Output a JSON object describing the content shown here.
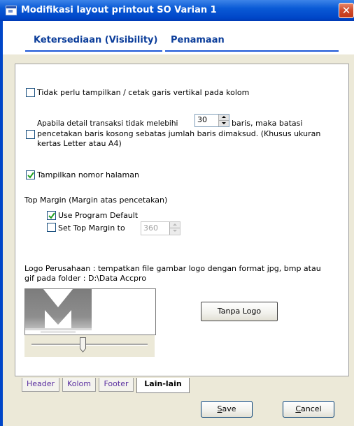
{
  "window": {
    "title": "Modifikasi layout printout SO Varian 1",
    "close_symbol": "✕"
  },
  "top_tabs": [
    {
      "label": "Ketersediaan (Visibility)"
    },
    {
      "label": "Penamaan"
    }
  ],
  "options": {
    "no_vertical_lines": {
      "label": "Tidak perlu tampilkan / cetak garis vertikal pada kolom",
      "checked": false
    },
    "limit_blank_rows": {
      "line1_prefix": "Apabila detail transaksi tidak melebihi",
      "value": "30",
      "line1_suffix": "baris, maka batasi",
      "line2": "pencetakan baris kosong sebatas jumlah baris dimaksud. (Khusus ukuran",
      "line3": "kertas Letter atau A4)",
      "checked": false
    },
    "show_page_number": {
      "label": "Tampilkan nomor halaman",
      "checked": true
    }
  },
  "top_margin": {
    "heading": "Top Margin (Margin atas pencetakan)",
    "use_default": {
      "label": "Use Program Default",
      "checked": true
    },
    "set_margin": {
      "label": "Set Top Margin to",
      "checked": false,
      "value": "360"
    }
  },
  "logo": {
    "line1": "Logo Perusahaan : tempatkan file gambar logo dengan format jpg, bmp atau",
    "line2": "gif pada folder : D:\\Data Accpro",
    "no_logo_button": "Tanpa Logo",
    "slider_value_percent": 44
  },
  "bottom_tabs": [
    {
      "label": "Header",
      "active": false
    },
    {
      "label": "Kolom",
      "active": false
    },
    {
      "label": "Footer",
      "active": false
    },
    {
      "label": "Lain-lain",
      "active": true
    }
  ],
  "buttons": {
    "save": {
      "accel": "S",
      "rest": "ave"
    },
    "cancel": {
      "accel": "C",
      "rest": "ancel"
    }
  },
  "colors": {
    "titlebar": "#0046c8",
    "accent_link": "#0b3d9a",
    "tab_text": "#5a2fa0",
    "check": "#21a121"
  }
}
